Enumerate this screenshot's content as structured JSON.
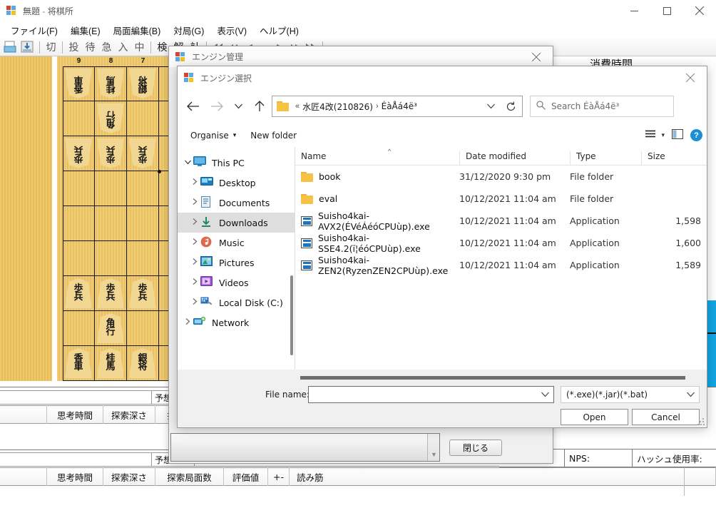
{
  "main_window": {
    "title": "無題",
    "title_separator": " - ",
    "app_name": "将棋所",
    "window_controls": {
      "minimize": "—",
      "maximize": "□",
      "close": "✕"
    },
    "menus": [
      {
        "label": "ファイル(F)"
      },
      {
        "label": "編集(E)"
      },
      {
        "label": "局面編集(B)"
      },
      {
        "label": "対局(G)"
      },
      {
        "label": "表示(V)"
      },
      {
        "label": "ヘルプ(H)"
      }
    ],
    "toolbar": {
      "icons": [
        "open-file-icon",
        "save-file-icon"
      ],
      "commands": [
        "切",
        "投",
        "待",
        "急",
        "入",
        "中",
        "検",
        "解",
        "計"
      ],
      "nav_arrows": [
        "⏮",
        "⏪",
        "◀",
        "■",
        "▶",
        "⏩",
        "⏭"
      ]
    },
    "consumed_time_label": "消費時間",
    "board": {
      "file_labels": [
        "9",
        "8",
        "7"
      ],
      "pieces": [
        {
          "file": 9,
          "rank": 1,
          "text": "香車",
          "side": "gote"
        },
        {
          "file": 8,
          "rank": 1,
          "text": "桂馬",
          "side": "gote"
        },
        {
          "file": 7,
          "rank": 1,
          "text": "銀将",
          "side": "gote"
        },
        {
          "file": 8,
          "rank": 2,
          "text": "角行",
          "side": "gote"
        },
        {
          "file": 9,
          "rank": 3,
          "text": "歩兵",
          "side": "gote"
        },
        {
          "file": 8,
          "rank": 3,
          "text": "歩兵",
          "side": "gote"
        },
        {
          "file": 7,
          "rank": 3,
          "text": "歩兵",
          "side": "gote"
        },
        {
          "file": 9,
          "rank": 7,
          "text": "歩兵",
          "side": "sente"
        },
        {
          "file": 8,
          "rank": 7,
          "text": "歩兵",
          "side": "sente"
        },
        {
          "file": 7,
          "rank": 7,
          "text": "歩兵",
          "side": "sente"
        },
        {
          "file": 8,
          "rank": 8,
          "text": "角行",
          "side": "sente"
        },
        {
          "file": 9,
          "rank": 9,
          "text": "香車",
          "side": "sente"
        },
        {
          "file": 8,
          "rank": 9,
          "text": "桂馬",
          "side": "sente"
        },
        {
          "file": 7,
          "rank": 9,
          "text": "銀将",
          "side": "sente"
        }
      ]
    },
    "engine_panels": [
      {
        "thin_row_label": "予想",
        "columns": [
          "思考時間",
          "探索深さ",
          "探索局面数"
        ]
      },
      {
        "thin_row_label": "予想",
        "columns": [
          "思考時間",
          "探索深さ",
          "探索局面数",
          "評価値",
          "+-",
          "読み筋"
        ]
      }
    ],
    "statusbar": {
      "nps_label": "NPS:",
      "hash_label": "ハッシュ使用率:"
    }
  },
  "engine_dialog": {
    "title": "エンジン管理",
    "close_label": "✕",
    "close_button": "閉じる"
  },
  "file_dialog": {
    "title": "エンジン選択",
    "close_label": "✕",
    "nav": {
      "back": "←",
      "forward": "→",
      "recent": "⌄",
      "up": "↑"
    },
    "address": {
      "prefix": "«",
      "crumbs": [
        "水匠4改(210826)",
        "ÉàÅá4ë³"
      ],
      "separator": "›",
      "chevron": "⌄",
      "refresh": "⟳"
    },
    "search": {
      "icon": "search-icon",
      "placeholder": "Search ÉàÅá4ë³"
    },
    "toolbar": {
      "organise": "Organise",
      "organise_caret": "▾",
      "new_folder": "New folder",
      "view_menu_caret": "▾",
      "preview_pane": "preview-pane-icon",
      "help": "?"
    },
    "nav_pane": [
      {
        "label": "This PC",
        "icon": "monitor-icon",
        "level": 1,
        "expanded": true,
        "selected": false
      },
      {
        "label": "Desktop",
        "icon": "desktop-icon",
        "level": 2,
        "expanded": false,
        "selected": false
      },
      {
        "label": "Documents",
        "icon": "documents-icon",
        "level": 2,
        "expanded": false,
        "selected": false
      },
      {
        "label": "Downloads",
        "icon": "downloads-icon",
        "level": 2,
        "expanded": false,
        "selected": true
      },
      {
        "label": "Music",
        "icon": "music-icon",
        "level": 2,
        "expanded": false,
        "selected": false
      },
      {
        "label": "Pictures",
        "icon": "pictures-icon",
        "level": 2,
        "expanded": false,
        "selected": false
      },
      {
        "label": "Videos",
        "icon": "videos-icon",
        "level": 2,
        "expanded": false,
        "selected": false
      },
      {
        "label": "Local Disk (C:)",
        "icon": "disk-icon",
        "level": 2,
        "expanded": false,
        "selected": false
      },
      {
        "label": "Network",
        "icon": "network-icon",
        "level": 1,
        "expanded": false,
        "selected": false
      }
    ],
    "columns": [
      "Name",
      "Date modified",
      "Type",
      "Size"
    ],
    "sort_indicator": "^",
    "files": [
      {
        "name": "book",
        "date": "31/12/2020 9:30 pm",
        "type": "File folder",
        "size": "",
        "icon": "folder-icon"
      },
      {
        "name": "eval",
        "date": "10/12/2021 11:04 am",
        "type": "File folder",
        "size": "",
        "icon": "folder-icon"
      },
      {
        "name": "Suisho4kai-AVX2(ÉVéÁéóCPUùp).exe",
        "date": "10/12/2021 11:04 am",
        "type": "Application",
        "size": "1,598",
        "icon": "application-icon"
      },
      {
        "name": "Suisho4kai-SSE4.2(ï¦éóCPUùp).exe",
        "date": "10/12/2021 11:04 am",
        "type": "Application",
        "size": "1,600",
        "icon": "application-icon"
      },
      {
        "name": "Suisho4kai-ZEN2(RyzenZEN2CPUùp).exe",
        "date": "10/12/2021 11:04 am",
        "type": "Application",
        "size": "1,589",
        "icon": "application-icon"
      }
    ],
    "filename": {
      "label": "File name:",
      "value": "",
      "chevron": "⌄"
    },
    "filter": {
      "value": "(*.exe)(*.jar)(*.bat)",
      "chevron": "⌄"
    },
    "buttons": {
      "open": "Open",
      "cancel": "Cancel"
    }
  },
  "colors": {
    "accent_blue": "#11a7e5",
    "board_wood": "#f0cd74",
    "piece_face": "#f2d793",
    "selection_gray": "#dedede",
    "folder_yellow": "#f5c243"
  }
}
